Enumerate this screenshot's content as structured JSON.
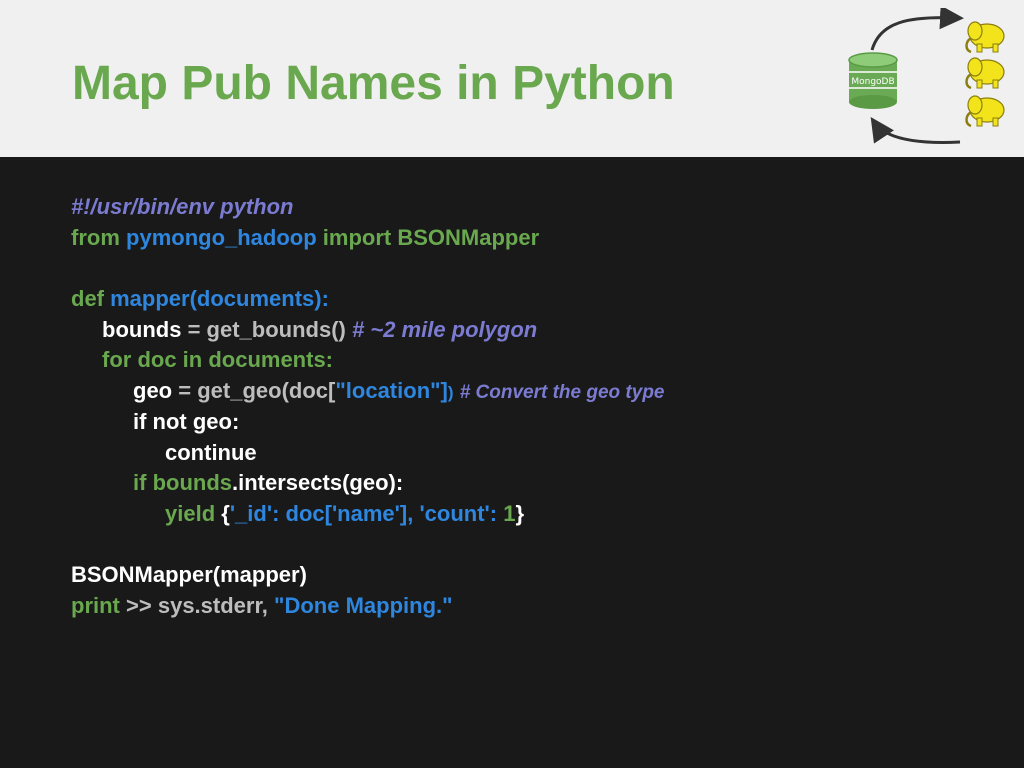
{
  "slide": {
    "title": "Map Pub Names in Python"
  },
  "diagram": {
    "db_label": "MongoDB",
    "colors": {
      "cylinder": "#6aaa55",
      "elephant": "#f2e31a",
      "arrow": "#333333"
    }
  },
  "colors": {
    "title": "#6aa84f",
    "keyword": "#6aa84f",
    "identifier": "#2e86de",
    "comment": "#7b7bd1",
    "plain": "#ffffff",
    "operator": "#bdbdbd",
    "background": "#191919",
    "header_background": "#f0f0f0"
  },
  "code": {
    "l1": {
      "shebang": "#!/usr/bin/env python"
    },
    "l2": {
      "kw_from": "from",
      "module": "pymongo_hadoop",
      "kw_import": "import",
      "class_name": "BSONMapper"
    },
    "l4": {
      "kw_def": "def",
      "signature": "mapper(documents):"
    },
    "l5": {
      "var": "bounds",
      "eq": "=",
      "call": "get_bounds()",
      "comment": "# ~2 mile polygon"
    },
    "l6": {
      "stmt": "for doc in documents:"
    },
    "l7": {
      "var": "geo",
      "eq": "=",
      "call": "get_geo(doc[",
      "str": "\"location\"]",
      "paren": ")",
      "comment": "# Convert the geo type"
    },
    "l8": {
      "stmt": "if not geo:"
    },
    "l9": {
      "stmt": "continue"
    },
    "l10": {
      "kw_if": "if",
      "var": "bounds",
      "rest": ".intersects(geo):"
    },
    "l11": {
      "kw_yield": "yield",
      "open": "{",
      "dict": "'_id': doc['name'], 'count':",
      "num": "1",
      "close": "}"
    },
    "l13": {
      "stmt": "BSONMapper(mapper)"
    },
    "l14": {
      "kw_print": "print",
      "op": ">>",
      "target": "sys.stderr,",
      "str": "\"Done Mapping.\""
    }
  }
}
